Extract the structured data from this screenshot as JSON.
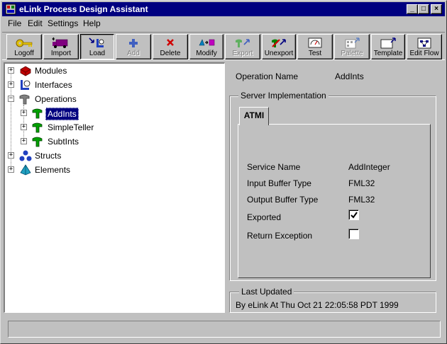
{
  "window": {
    "title": "eLink Process Design Assistant",
    "minimize_glyph": "_",
    "maximize_glyph": "□",
    "close_glyph": "×"
  },
  "menu": [
    "File",
    "Edit",
    "Settings",
    "Help"
  ],
  "toolbar": [
    {
      "label": "Logoff",
      "icon": "key-icon",
      "enabled": true
    },
    {
      "label": "Import",
      "icon": "truck-import-icon",
      "enabled": true
    },
    {
      "label": "Load",
      "icon": "load-icon",
      "enabled": true
    },
    {
      "label": "Add",
      "icon": "plus-icon",
      "enabled": false
    },
    {
      "label": "Delete",
      "icon": "x-delete-icon",
      "enabled": true
    },
    {
      "label": "Modify",
      "icon": "modify-shapes-icon",
      "enabled": true
    },
    {
      "label": "Export",
      "icon": "export-icon",
      "enabled": false
    },
    {
      "label": "Unexport",
      "icon": "unexport-icon",
      "enabled": true
    },
    {
      "label": "Test",
      "icon": "gauge-test-icon",
      "enabled": true
    },
    {
      "label": "Palette",
      "icon": "palette-icon",
      "enabled": false
    },
    {
      "label": "Template",
      "icon": "template-icon",
      "enabled": true
    },
    {
      "label": "Edit Flow",
      "icon": "edit-flow-icon",
      "enabled": true
    }
  ],
  "tree": [
    {
      "label": "Modules",
      "icon": "modules-icon",
      "expander": "+",
      "level": 0
    },
    {
      "label": "Interfaces",
      "icon": "interfaces-icon",
      "expander": "+",
      "level": 0
    },
    {
      "label": "Operations",
      "icon": "operations-icon",
      "expander": "−",
      "level": 0
    },
    {
      "label": "AddInts",
      "icon": "operation-icon",
      "expander": "+",
      "level": 1,
      "selected": true
    },
    {
      "label": "SimpleTeller",
      "icon": "operation-icon",
      "expander": "+",
      "level": 1
    },
    {
      "label": "SubtInts",
      "icon": "operation-icon",
      "expander": "+",
      "level": 1
    },
    {
      "label": "Structs",
      "icon": "structs-icon",
      "expander": "+",
      "level": 0
    },
    {
      "label": "Elements",
      "icon": "elements-icon",
      "expander": "+",
      "level": 0
    }
  ],
  "details": {
    "operation_name_label": "Operation Name",
    "operation_name_value": "AddInts",
    "server_impl_title": "Server Implementation",
    "tab_label": "ATMI",
    "service_name_label": "Service Name",
    "service_name_value": "AddInteger",
    "input_buffer_label": "Input Buffer Type",
    "input_buffer_value": "FML32",
    "output_buffer_label": "Output Buffer Type",
    "output_buffer_value": "FML32",
    "exported_label": "Exported",
    "exported_checked": true,
    "return_exception_label": "Return Exception",
    "return_exception_checked": false,
    "last_updated_title": "Last Updated",
    "last_updated_value": "By eLink At Thu Oct 21 22:05:58 PDT 1999"
  },
  "status": {
    "text": ""
  }
}
